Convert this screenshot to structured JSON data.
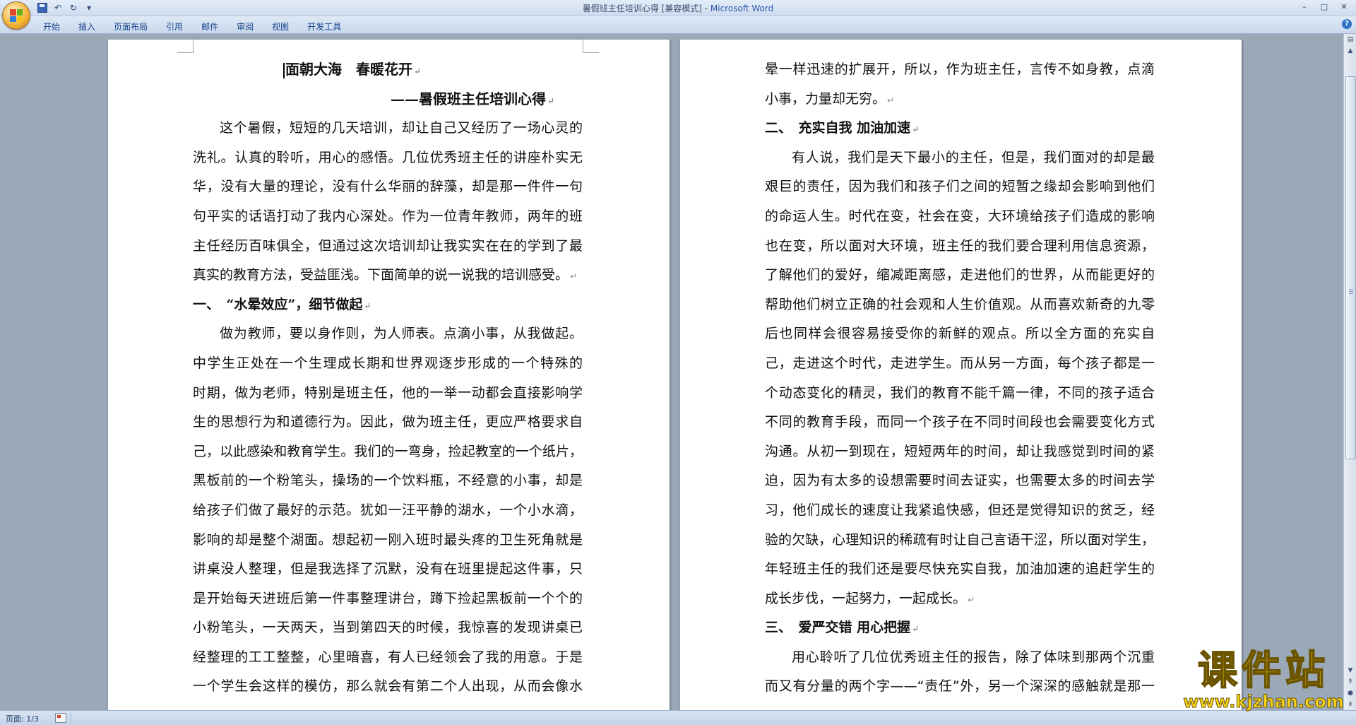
{
  "window": {
    "title": "暑假班主任培训心得 [兼容模式] - ",
    "app_name": "Microsoft Word",
    "controls": [
      "–",
      "□",
      "✕"
    ]
  },
  "ribbon": {
    "tabs": [
      "开始",
      "插入",
      "页面布局",
      "引用",
      "邮件",
      "审阅",
      "视图",
      "开发工具"
    ]
  },
  "document": {
    "left_page": {
      "title": "面朝大海　春暖花开",
      "subtitle": "——暑假班主任培训心得",
      "lines": [
        "这个暑假，短短的几天培训，却让自己又经历了一场心灵的",
        "洗礼。认真的聆听，用心的感悟。几位优秀班主任的讲座朴实无",
        "华，没有大量的理论，没有什么华丽的辞藻，却是那一件件一句",
        "句平实的话语打动了我内心深处。作为一位青年教师，两年的班",
        "主任经历百味俱全，但通过这次培训却让我实实在在的学到了最",
        "真实的教育方法，受益匪浅。下面简单的说一说我的培训感受。",
        "一、　“水晕效应”，细节做起",
        "做为教师，要以身作则，为人师表。点滴小事，从我做起。",
        "中学生正处在一个生理成长期和世界观逐步形成的一个特殊的",
        "时期，做为老师，特别是班主任，他的一举一动都会直接影响学",
        "生的思想行为和道德行为。因此，做为班主任，更应严格要求自",
        "己，以此感染和教育学生。我们的一弯身，捡起教室的一个纸片，",
        "黑板前的一个粉笔头，操场的一个饮料瓶，不经意的小事，却是",
        "给孩子们做了最好的示范。犹如一汪平静的湖水，一个小水滴，",
        "影响的却是整个湖面。想起初一刚入班时最头疼的卫生死角就是",
        "讲桌没人整理，但是我选择了沉默，没有在班里提起这件事，只",
        "是开始每天进班后第一件事整理讲台，蹲下捡起黑板前一个个的",
        "小粉笔头，一天两天，当到第四天的时候，我惊喜的发现讲桌已",
        "经整理的工工整整，心里暗喜，有人已经领会了我的用意。于是",
        "一个学生会这样的模仿，那么就会有第二个人出现，从而会像水"
      ]
    },
    "right_page": {
      "lines": [
        "晕一样迅速的扩展开，所以，作为班主任，言传不如身教，点滴",
        "小事，力量却无穷。",
        "二、　充实自我 加油加速",
        "有人说，我们是天下最小的主任，但是，我们面对的却是最",
        "艰巨的责任，因为我们和孩子们之间的短暂之缘却会影响到他们",
        "的命运人生。时代在变，社会在变，大环境给孩子们造成的影响",
        "也在变，所以面对大环境，班主任的我们要合理利用信息资源，",
        "了解他们的爱好，缩减距离感，走进他们的世界，从而能更好的",
        "帮助他们树立正确的社会观和人生价值观。从而喜欢新奇的九零",
        "后也同样会很容易接受你的新鲜的观点。所以全方面的充实自",
        "己，走进这个时代，走进学生。而从另一方面，每个孩子都是一",
        "个动态变化的精灵，我们的教育不能千篇一律，不同的孩子适合",
        "不同的教育手段，而同一个孩子在不同时间段也会需要变化方式",
        "沟通。从初一到现在，短短两年的时间，却让我感觉到时间的紧",
        "迫，因为有太多的设想需要时间去证实，也需要太多的时间去学",
        "习，他们成长的速度让我紧追快感，但还是觉得知识的贫乏，经",
        "验的欠缺，心理知识的稀疏有时让自己言语干涩，所以面对学生，",
        "年轻班主任的我们还是要尽快充实自我，加油加速的追赶学生的",
        "成长步伐，一起努力，一起成长。",
        "三、　爱严交错 用心把握",
        "用心聆听了几位优秀班主任的报告，除了体味到那两个沉重",
        "而又有分量的两个字——“责任”外，另一个深深的感触就是那一"
      ]
    }
  },
  "statusbar": {
    "page_info": "页面: 1/3"
  },
  "watermark": {
    "cn": "课件站",
    "url": "www.kjzhan.com"
  }
}
